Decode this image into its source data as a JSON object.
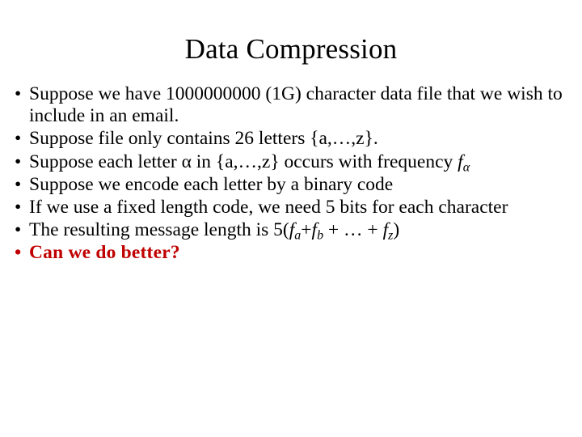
{
  "slide": {
    "title": "Data Compression",
    "background_color": "#FFFFFF",
    "text_color": "#000000",
    "accent_color": "#C00000",
    "bullet_glyph": "•"
  },
  "bullets": [
    {
      "id": "bullet-file-size",
      "text": "Suppose we have 1000000000 (1G) character data file that we wish to include in an email."
    },
    {
      "id": "bullet-alphabet",
      "text": "Suppose file only contains 26 letters {a,…,z}."
    },
    {
      "id": "bullet-frequency",
      "prefix": "Suppose each letter α in {a,…,z} occurs with frequency ",
      "symbol": "f",
      "subscript": "α",
      "suffix": ""
    },
    {
      "id": "bullet-binary-code",
      "text": "Suppose we encode each letter by a binary code"
    },
    {
      "id": "bullet-fixed-length",
      "text": "If we use a fixed length code, we need 5 bits for each character"
    },
    {
      "id": "bullet-message-length",
      "prefix": "The resulting message length is 5(",
      "term_1_symbol": "f",
      "term_1_sub": "a",
      "operator_1": "+",
      "term_2_symbol": "f",
      "term_2_sub": "b",
      "operator_2": " + … + ",
      "term_3_symbol": "f",
      "term_3_sub": "z",
      "suffix": ")"
    },
    {
      "id": "bullet-can-we-do-better",
      "text": "Can we do better?"
    }
  ]
}
